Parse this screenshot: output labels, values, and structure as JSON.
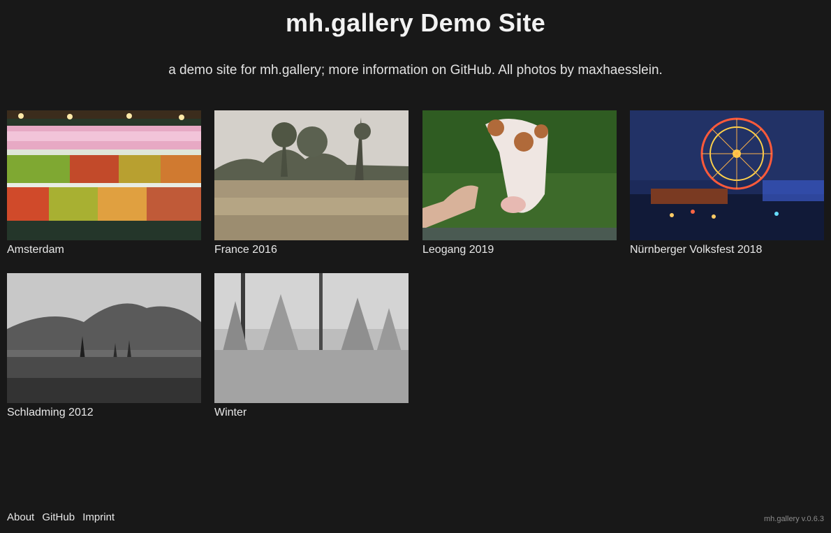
{
  "header": {
    "title": "mh.gallery Demo Site",
    "subtitle_parts": {
      "pre": "a demo site for ",
      "link_mhgallery": "mh.gallery",
      "mid": "; more information on ",
      "link_github": "GitHub",
      "mid2": ". All photos by ",
      "link_author": "maxhaesslein",
      "post": "."
    }
  },
  "galleries": [
    {
      "title": "Amsterdam",
      "image": "macaron-display-photo"
    },
    {
      "title": "France 2016",
      "image": "grassland-trees-photo"
    },
    {
      "title": "Leogang 2019",
      "image": "cow-being-fed-photo"
    },
    {
      "title": "Nürnberger Volksfest 2018",
      "image": "ferris-wheel-night-photo"
    },
    {
      "title": "Schladming 2012",
      "image": "mountain-meadow-bw-photo"
    },
    {
      "title": "Winter",
      "image": "snowy-forest-photo"
    }
  ],
  "footer": {
    "links": [
      "About",
      "GitHub",
      "Imprint"
    ],
    "version": "mh.gallery v.0.6.3"
  },
  "colors": {
    "background": "#181818",
    "text": "#ededed",
    "muted": "#8c8c8c"
  }
}
